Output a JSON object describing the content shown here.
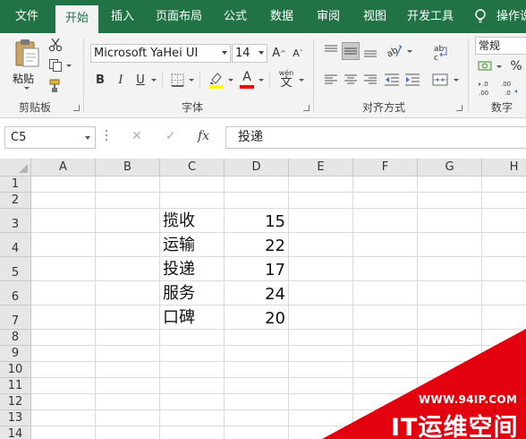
{
  "ribbon_tabs": [
    {
      "label": "文件",
      "active": false
    },
    {
      "label": "开始",
      "active": true
    },
    {
      "label": "插入",
      "active": false
    },
    {
      "label": "页面布局",
      "active": false
    },
    {
      "label": "公式",
      "active": false
    },
    {
      "label": "数据",
      "active": false
    },
    {
      "label": "审阅",
      "active": false
    },
    {
      "label": "视图",
      "active": false
    },
    {
      "label": "开发工具",
      "active": false
    }
  ],
  "tell_me": {
    "icon": "lightbulb-icon",
    "label": "操作说"
  },
  "clipboard_group": {
    "label": "剪贴板",
    "paste_label": "粘贴",
    "icons": [
      "paste-icon",
      "cut-icon",
      "copy-icon",
      "format-painter-icon"
    ]
  },
  "font_group": {
    "label": "字体",
    "font_name": "Microsoft YaHei UI",
    "font_size": "14",
    "grow_label": "A",
    "shrink_label": "A",
    "bold_label": "B",
    "italic_label": "I",
    "underline_label": "U",
    "font_color_label": "A",
    "phonetic_label": "wén",
    "colors": {
      "highlight": "#ffff00",
      "font_color": "#ff0000"
    }
  },
  "alignment_group": {
    "label": "对齐方式"
  },
  "number_group": {
    "label": "数字",
    "format": "常规",
    "percent_label": "%"
  },
  "formula_bar": {
    "name_box": "C5",
    "cancel_label": "✕",
    "enter_label": "✓",
    "fx_label": "fx",
    "formula": "投递"
  },
  "sheet": {
    "columns": [
      "A",
      "B",
      "C",
      "D",
      "E",
      "F",
      "G",
      "H"
    ],
    "rows": [
      "1",
      "2",
      "3",
      "4",
      "5",
      "6",
      "7",
      "8",
      "9",
      "10",
      "11",
      "12",
      "13",
      "14"
    ],
    "data": [
      {
        "label": "揽收",
        "value": "15"
      },
      {
        "label": "运输",
        "value": "22"
      },
      {
        "label": "投递",
        "value": "17"
      },
      {
        "label": "服务",
        "value": "24"
      },
      {
        "label": "口碑",
        "value": "20"
      }
    ]
  },
  "watermark": {
    "url": "WWW.94IP.COM",
    "brand": "IT运维空间"
  },
  "colors": {
    "excel_green": "#217346",
    "watermark_red": "#e3000f"
  }
}
